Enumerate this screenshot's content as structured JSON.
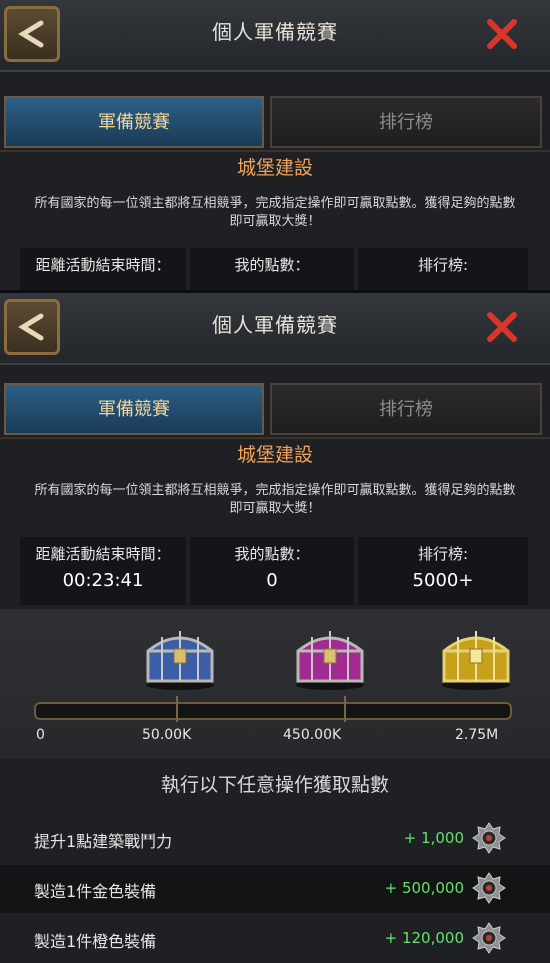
{
  "window_title": "個人軍備競賽",
  "tabs": {
    "active": "軍備競賽",
    "inactive": "排行榜"
  },
  "event": {
    "section_title": "城堡建設",
    "description": "所有國家的每一位領主都將互相競爭，完成指定操作即可贏取點數。獲得足夠的點數即可贏取大獎！"
  },
  "stats": {
    "time_left_label": "距離活動結束時間：",
    "time_left_value": "00:23:41",
    "my_points_label": "我的點數：",
    "my_points_value": "0",
    "rank_label": "排行榜:",
    "rank_value": "5000+"
  },
  "progress": {
    "marks": [
      "0",
      "50.00K",
      "450.00K",
      "2.75M"
    ],
    "fill_fraction": 0
  },
  "chests": [
    {
      "icon": "blue-chest-icon",
      "color": "#3b5ea6"
    },
    {
      "icon": "purple-chest-icon",
      "color": "#a32a91"
    },
    {
      "icon": "gold-chest-icon",
      "color": "#c7a11a"
    }
  ],
  "tasks_title": "執行以下任意操作獲取點數",
  "tasks": [
    {
      "label": "提升1點建築戰鬥力",
      "points": "+ 1,000"
    },
    {
      "label": "製造1件金色裝備",
      "points": "+ 500,000"
    },
    {
      "label": "製造1件橙色裝備",
      "points": "+ 120,000"
    }
  ],
  "colors": {
    "accent": "#f0a15b",
    "points": "#67e06b",
    "tab_active": "#2d5f86"
  }
}
